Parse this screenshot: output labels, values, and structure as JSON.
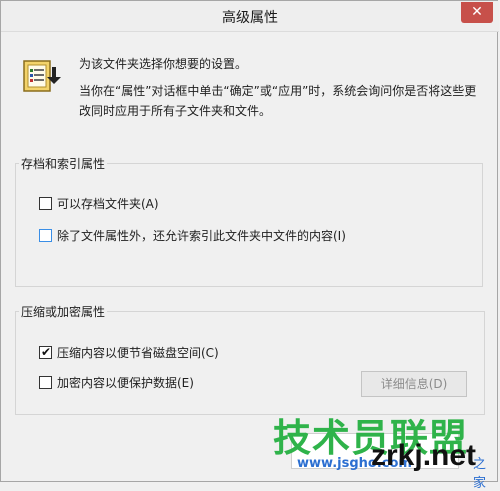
{
  "window": {
    "title": "高级属性",
    "close_glyph": "✕"
  },
  "intro": {
    "line1": "为该文件夹选择你想要的设置。",
    "line2": "当你在“属性”对话框中单击“确定”或“应用”时，系统会询问你是否将这些更改同时应用于所有子文件夹和文件。"
  },
  "archive_group": {
    "title": "存档和索引属性",
    "options": [
      {
        "label": "可以存档文件夹(A)",
        "checked": false
      },
      {
        "label": "除了文件属性外，还允许索引此文件夹中文件的内容(I)",
        "checked": false
      }
    ]
  },
  "compress_group": {
    "title": "压缩或加密属性",
    "options": [
      {
        "label": "压缩内容以便节省磁盘空间(C)",
        "checked": true
      },
      {
        "label": "加密内容以便保护数据(E)",
        "checked": false
      }
    ],
    "details_button": "详细信息(D)"
  },
  "watermark": {
    "cn_text": "技术员联盟",
    "url": "www.jsgho.com",
    "brand": "zrkj.net",
    "suffix": "之家"
  },
  "colors": {
    "accent": "#3a8ee6",
    "close": "#c7504a",
    "watermark_green": "#2fb34a"
  }
}
